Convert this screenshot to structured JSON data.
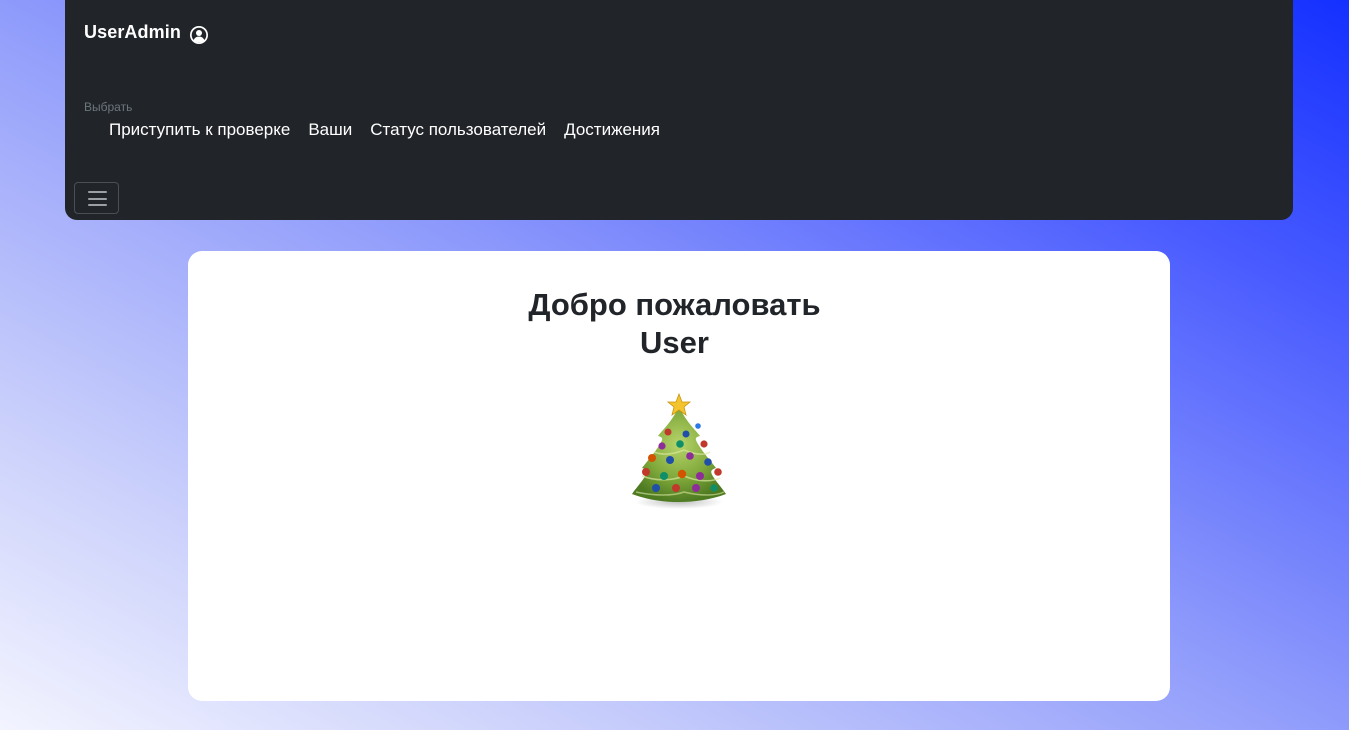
{
  "navbar": {
    "brand": "UserAdmin",
    "brand_icon": "user-circle-icon",
    "select_label": "Выбрать",
    "links": [
      {
        "label": "Приступить к проверке"
      },
      {
        "label": "Ваши"
      },
      {
        "label": "Статус пользователей"
      },
      {
        "label": "Достижения"
      }
    ],
    "toggler_icon": "hamburger-menu-icon"
  },
  "main": {
    "greeting": "Добро пожаловать",
    "username": "User",
    "image_icon": "christmas-tree-icon"
  },
  "colors": {
    "navbar_bg": "#212529",
    "card_bg": "#ffffff",
    "gradient_start": "#f3f4ff",
    "gradient_end": "#1430ff",
    "heading_text": "#212529"
  }
}
